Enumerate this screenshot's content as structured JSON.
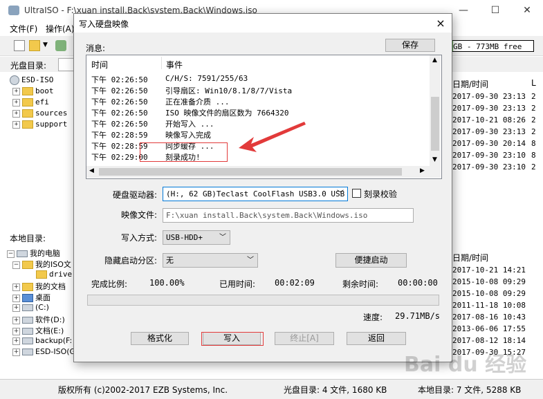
{
  "main_window": {
    "title": "UltraISO - F:\\xuan install.Back\\system.Back\\Windows.iso",
    "menu": [
      "文件(F)",
      "操作(A)"
    ],
    "size_indicator": "GB - 773MB free",
    "iso_dir_label": "光盘目录:",
    "local_dir_label": "本地目录:"
  },
  "iso_tree": [
    {
      "label": "ESD-ISO",
      "icon": "disc-icon"
    },
    {
      "label": "boot",
      "icon": "folder-icon"
    },
    {
      "label": "efi",
      "icon": "folder-icon"
    },
    {
      "label": "sources",
      "icon": "folder-icon"
    },
    {
      "label": "support",
      "icon": "folder-icon"
    }
  ],
  "local_tree": [
    {
      "label": "我的电脑",
      "icon": "computer-icon"
    },
    {
      "label": "我的ISO文",
      "icon": "folder-icon"
    },
    {
      "label": "driver",
      "icon": "folder-icon"
    },
    {
      "label": "我的文档",
      "icon": "folder-icon"
    },
    {
      "label": "桌面",
      "icon": "folder-icon"
    },
    {
      "label": "(C:)",
      "icon": "drive-icon"
    },
    {
      "label": "软件(D:)",
      "icon": "drive-icon"
    },
    {
      "label": "文档(E:)",
      "icon": "drive-icon"
    },
    {
      "label": "backup(F:",
      "icon": "drive-icon"
    },
    {
      "label": "ESD-ISO(G",
      "icon": "drive-icon"
    }
  ],
  "right_top": {
    "header": "日期/时间",
    "header2": "L",
    "rows": [
      {
        "date": "2017-09-30 23:13",
        "c": "2"
      },
      {
        "date": "2017-09-30 23:13",
        "c": "2"
      },
      {
        "date": "2017-10-21 08:26",
        "c": "2"
      },
      {
        "date": "2017-09-30 23:13",
        "c": "2"
      },
      {
        "date": "2017-09-30 20:14",
        "c": "8"
      },
      {
        "date": "2017-09-30 23:10",
        "c": "8"
      },
      {
        "date": "2017-09-30 23:10",
        "c": "2"
      }
    ]
  },
  "right_bottom": {
    "header": "日期/时间",
    "rows": [
      "2017-10-21 14:21",
      "2015-10-08 09:29",
      "2015-10-08 09:29",
      "2011-11-18 10:08",
      "2017-08-16 10:43",
      "2013-06-06 17:55",
      "2017-08-12 18:14",
      "2017-09-30 15:27"
    ]
  },
  "statusbar": {
    "copyright": "版权所有 (c)2002-2017 EZB Systems, Inc.",
    "iso_dir": "光盘目录: 4 文件, 1680 KB",
    "local_dir": "本地目录: 7 文件, 5288 KB"
  },
  "dialog": {
    "title": "写入硬盘映像",
    "close_icon": "×",
    "messages_label": "消息:",
    "save_label": "保存",
    "log_header": {
      "time": "时间",
      "event": "事件"
    },
    "log": [
      {
        "time": "下午 02:26:50",
        "event": "C/H/S: 7591/255/63"
      },
      {
        "time": "下午 02:26:50",
        "event": "引导扇区: Win10/8.1/8/7/Vista"
      },
      {
        "time": "下午 02:26:50",
        "event": "正在准备介质 ..."
      },
      {
        "time": "下午 02:26:50",
        "event": "ISO 映像文件的扇区数为 7664320"
      },
      {
        "time": "下午 02:26:50",
        "event": "开始写入 ..."
      },
      {
        "time": "下午 02:28:59",
        "event": "映像写入完成"
      },
      {
        "time": "下午 02:28:59",
        "event": "同步缓存 ..."
      },
      {
        "time": "下午 02:29:00",
        "event": "刻录成功!"
      }
    ],
    "drive_label": "硬盘驱动器:",
    "drive_value": "(H:, 62 GB)Teclast CoolFlash USB3.0 USB",
    "verify_label": "刻录校验",
    "image_label": "映像文件:",
    "image_value": "F:\\xuan install.Back\\system.Back\\Windows.iso",
    "write_mode_label": "写入方式:",
    "write_mode_value": "USB-HDD+",
    "hidden_label": "隐藏启动分区:",
    "hidden_value": "无",
    "quick_boot_label": "便捷启动",
    "progress_label": "完成比例:",
    "progress_value": "100.00%",
    "progress_fraction": 1.0,
    "elapsed_label": "已用时间:",
    "elapsed_value": "00:02:09",
    "remaining_label": "剩余时间:",
    "remaining_value": "00:00:00",
    "speed_label": "速度:",
    "speed_value": "29.71MB/s",
    "buttons": {
      "format": "格式化",
      "write": "写入",
      "stop": "终止[A]",
      "back": "返回"
    }
  },
  "watermark": "Bai du 经验",
  "colors": {
    "annotation": "#e23a3a",
    "progress_fill": "#06b025"
  }
}
